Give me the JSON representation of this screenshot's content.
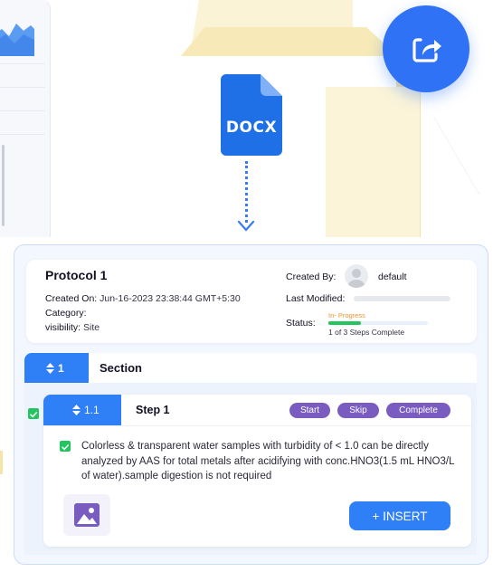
{
  "file_badge": {
    "label": "DOCX",
    "icon": "docx-file-icon"
  },
  "share": {
    "icon": "share-icon",
    "color": "#2f72f5"
  },
  "protocol": {
    "title": "Protocol 1",
    "created_on_label": "Created On:",
    "created_on_value": "Jun-16-2023 23:38:44 GMT+5:30",
    "category_label": "Category:",
    "category_value": "",
    "visibility_label": "visibility:",
    "visibility_value": "Site",
    "created_by_label": "Created By:",
    "created_by_value": "default",
    "last_modified_label": "Last Modified:",
    "status_label": "Status:",
    "status_state": "In- Progress",
    "status_progress_text": "1 of 3 Steps Complete",
    "status_progress_fraction": 0.33
  },
  "section": {
    "number": "1",
    "title": "Section",
    "sort_icon": "sort-arrows-icon"
  },
  "step": {
    "number": "1.1",
    "title": "Step 1",
    "actions": {
      "start": "Start",
      "skip": "Skip",
      "complete": "Complete"
    },
    "item_text": "Colorless & transparent water samples with turbidity of < 1.0 can be directly analyzed by AAS for total metals after acidifying with conc.HNO3(1.5 mL HNO3/L of water).sample digestion is not  required",
    "insert_label": "+ INSERT"
  },
  "colors": {
    "primary": "#2f7ff6",
    "action_pill": "#7a5cc0",
    "success": "#22c55e",
    "in_progress": "#f0932b"
  }
}
